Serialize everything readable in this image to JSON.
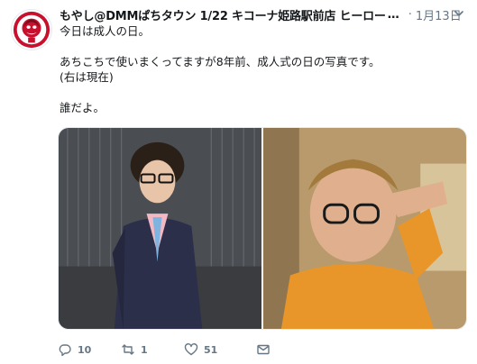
{
  "tweet": {
    "display_name": "もやし@DMMぱちタウン 1/22 キコーナ姫路駅前店 ヒーロー",
    "ellipsis": "…",
    "separator": "·",
    "timestamp": "1月13日",
    "lines": [
      "今日は成人の日。",
      "",
      "あちこちで使いまくってますが8年前、成人式の日の写真です。",
      "(右は現在)",
      "",
      "誰だよ。"
    ],
    "actions": {
      "reply_count": "10",
      "retweet_count": "1",
      "like_count": "51"
    }
  },
  "icons": {
    "avatar": "avatar-icon",
    "caret": "chevron-down-icon",
    "reply": "reply-icon",
    "retweet": "retweet-icon",
    "like": "heart-icon",
    "message": "envelope-icon"
  },
  "colors": {
    "text": "#14171a",
    "secondary": "#657786",
    "avatar_red": "#c8102e",
    "hoodie_orange": "#e8962a"
  }
}
